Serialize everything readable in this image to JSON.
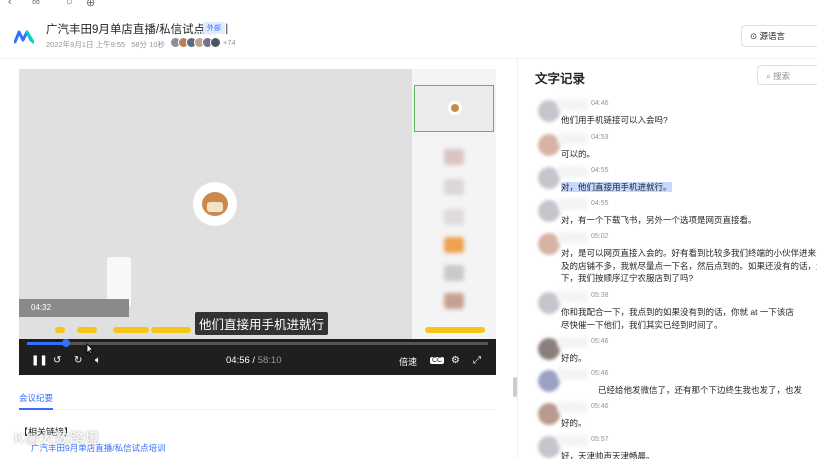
{
  "header": {
    "title": "广汽丰田9月单店直播/私信试点培训",
    "tag": "外部",
    "date": "2022年9月1日 上午9:55",
    "duration": "58分 10秒",
    "participants_extra": "+74",
    "lang_button": "源语言"
  },
  "video": {
    "overlay_time": "04:32",
    "subtitle": "他们直接用手机进就行",
    "current_time": "04:56",
    "total_time": "58:10",
    "speed_label": "倍速",
    "cc_label": "CC",
    "progress_fraction": 0.085
  },
  "below": {
    "tab": "会议纪要",
    "related_title": "【相关链接】",
    "related_link": "广汽丰田9月单店直播/私信试点培训",
    "watermark": "K@大数跨境"
  },
  "transcript": {
    "title": "文字记录",
    "search_placeholder": "搜索",
    "entries": [
      {
        "time": "04:46",
        "text": "他们用手机链接可以入会吗?"
      },
      {
        "time": "04:53",
        "text": "可以的。"
      },
      {
        "time": "04:55",
        "text": "对，他们直接用手机进就行。"
      },
      {
        "time": "04:55",
        "text": "对，有一个下载飞书，另外一个选项是网页直接看。"
      },
      {
        "time": "05:02",
        "text": "对，是可以网页直接入会的。好有看到比较多我们终端的小伙伴进来了",
        "text2": "及的店铺不多，我就尽量点一下名，然后点到的。如果还没有的话，大",
        "text3": "下，我们按顺序辽宁农服店到了吗?"
      },
      {
        "time": "05:38",
        "text": "你和我配合一下，我点到的如果没有到的话，你就 at 一下该店",
        "text2": "尽快催一下他们，我们其实已经到时间了。"
      },
      {
        "time": "05:46",
        "text": "好的。"
      },
      {
        "time": "05:46",
        "text": "已经给他发微信了，还有那个下边终生我也发了，也发"
      },
      {
        "time": "05:46",
        "text": "好的。"
      },
      {
        "time": "05:57",
        "text": "好，天津帅声天津畅晨。"
      }
    ]
  },
  "colors": {
    "accent": "#3370ff",
    "highlight": "#f5c518",
    "control_bar": "#1f1f1f"
  }
}
